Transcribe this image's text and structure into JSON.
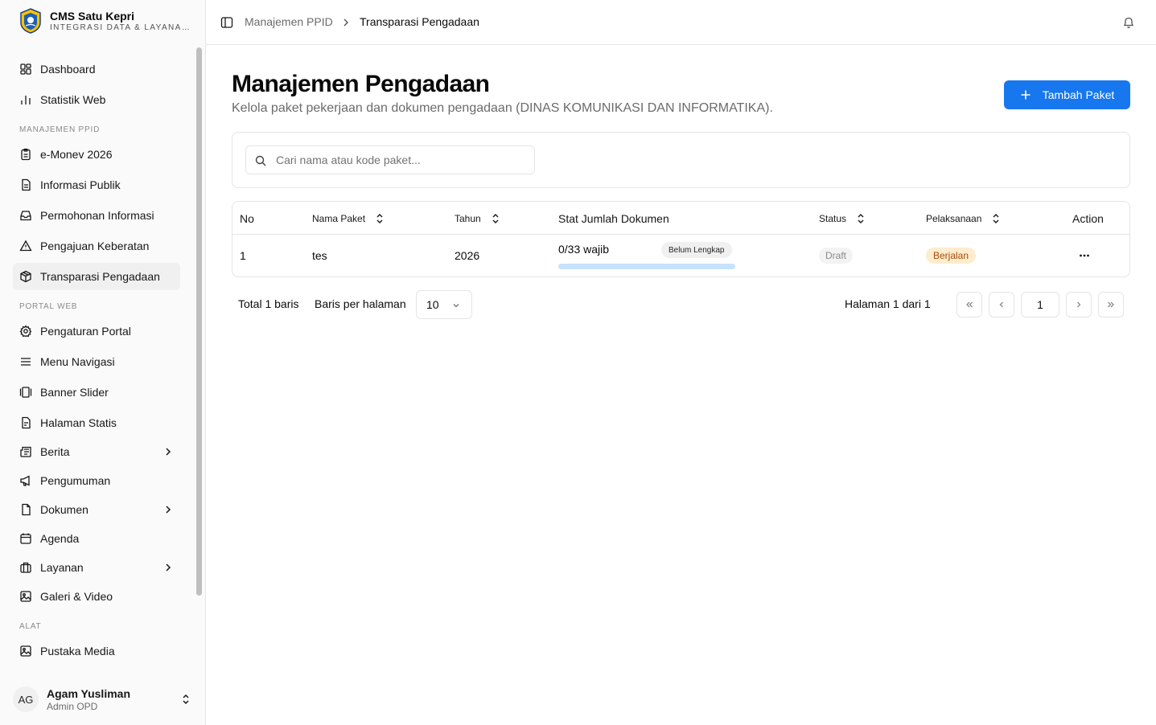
{
  "brand": {
    "title": "CMS Satu Kepri",
    "subtitle": "INTEGRASI DATA & LAYANA…"
  },
  "sidebar": {
    "items": [
      {
        "label": "Dashboard",
        "icon": "dashboard-icon"
      },
      {
        "label": "Statistik Web",
        "icon": "bar-chart-icon"
      }
    ],
    "group_ppid": "MANAJEMEN PPID",
    "ppid_items": [
      {
        "label": "e-Monev 2026",
        "icon": "clipboard-icon"
      },
      {
        "label": "Informasi Publik",
        "icon": "file-text-icon"
      },
      {
        "label": "Permohonan Informasi",
        "icon": "inbox-icon"
      },
      {
        "label": "Pengajuan Keberatan",
        "icon": "warning-icon"
      },
      {
        "label": "Transparasi Pengadaan",
        "icon": "package-icon",
        "active": true
      }
    ],
    "group_portal": "PORTAL WEB",
    "portal_items": [
      {
        "label": "Pengaturan Portal",
        "icon": "gear-icon"
      },
      {
        "label": "Menu Navigasi",
        "icon": "menu-icon"
      },
      {
        "label": "Banner Slider",
        "icon": "gallery-icon"
      },
      {
        "label": "Halaman Statis",
        "icon": "file-icon"
      },
      {
        "label": "Berita",
        "icon": "newspaper-icon",
        "has_children": true
      },
      {
        "label": "Pengumuman",
        "icon": "megaphone-icon"
      },
      {
        "label": "Dokumen",
        "icon": "document-icon",
        "has_children": true
      },
      {
        "label": "Agenda",
        "icon": "calendar-icon"
      },
      {
        "label": "Layanan",
        "icon": "briefcase-icon",
        "has_children": true
      },
      {
        "label": "Galeri & Video",
        "icon": "image-icon"
      }
    ],
    "group_tools": "ALAT",
    "tools_items": [
      {
        "label": "Pustaka Media",
        "icon": "image-icon"
      }
    ]
  },
  "user": {
    "initials": "AG",
    "name": "Agam Yusliman",
    "role": "Admin OPD"
  },
  "breadcrumb": {
    "parent": "Manajemen PPID",
    "current": "Transparasi Pengadaan"
  },
  "page": {
    "title": "Manajemen Pengadaan",
    "description": "Kelola paket pekerjaan dan dokumen pengadaan (DINAS KOMUNIKASI DAN INFORMATIKA).",
    "add_button": "Tambah Paket"
  },
  "search": {
    "placeholder": "Cari nama atau kode paket...",
    "value": ""
  },
  "table": {
    "headers": {
      "no": "No",
      "nama": "Nama Paket",
      "tahun": "Tahun",
      "stat": "Stat Jumlah Dokumen",
      "status": "Status",
      "pelaksanaan": "Pelaksanaan",
      "action": "Action"
    },
    "rows": [
      {
        "no": "1",
        "nama": "tes",
        "tahun": "2026",
        "doc_count": "0/33 wajib",
        "doc_progress": 0,
        "completeness": "Belum Lengkap",
        "status": "Draft",
        "pelaksanaan": "Berjalan"
      }
    ]
  },
  "pagination": {
    "total": "Total 1 baris",
    "rows_label": "Baris per halaman",
    "rows_value": "10",
    "page_label": "Halaman 1 dari 1",
    "current_page": "1"
  },
  "colors": {
    "primary": "#1677ee",
    "progress_track": "#c6e2ff",
    "berjalan_bg": "#fdeccd",
    "berjalan_text": "#a84a0a"
  }
}
